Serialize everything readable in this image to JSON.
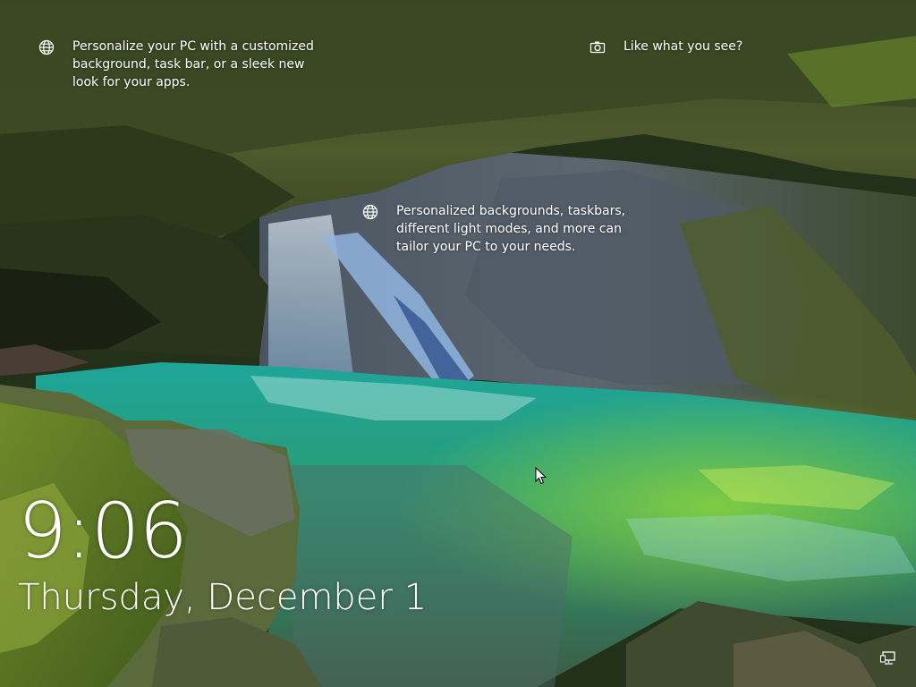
{
  "lockscreen": {
    "hotspots": [
      {
        "icon": "globe-icon",
        "text": "Personalize your PC with a customized background, task bar, or a sleek new look for your apps."
      },
      {
        "icon": "camera-icon",
        "text": "Like what you see?"
      },
      {
        "icon": "globe-icon",
        "text": "Personalized backgrounds, taskbars, different light modes, and more can tailor your PC to your needs."
      }
    ],
    "time": "9:06",
    "date": "Thursday, December 1",
    "status_icons": [
      "network-icon"
    ]
  }
}
